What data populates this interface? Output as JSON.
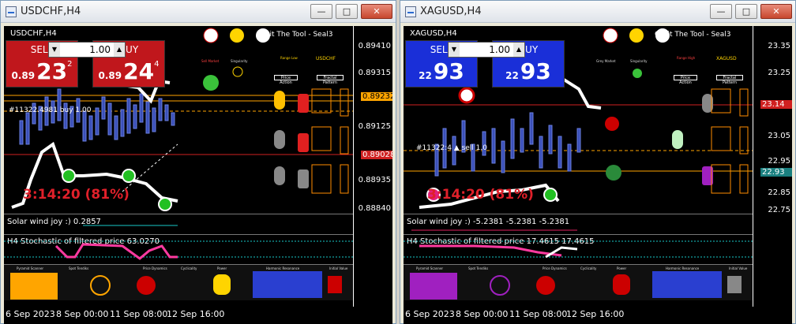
{
  "windows": [
    {
      "id": "left",
      "title": "USDCHF,H4",
      "symbol_label": "USDCHF,H4",
      "sell_label": "SELL",
      "buy_label": "BUY",
      "lot": "1.00",
      "sell_price": {
        "small": "0.89",
        "big": "23",
        "sup": "2"
      },
      "buy_price": {
        "small": "0.89",
        "big": "24",
        "sup": "4"
      },
      "seal_text": "Orbit The Tool - Seal3",
      "pair_tag": "USDCHF",
      "prices": [
        "0.89410",
        "0.89315",
        "0.89232",
        "0.89125",
        "0.89028",
        "0.88935",
        "0.88840"
      ],
      "trade_label": "#11322.4981 buy 1.00",
      "countdown": "3:14:20 (81%)",
      "solar_text": "Solar wind joy :) 0.2857",
      "stoch_text": "H4 Stochastic of filtered price 63.0270",
      "stoch_levels": [
        "80",
        "20"
      ],
      "time_labels": [
        "6 Sep 2023",
        "8 Sep 00:00",
        "11 Sep 08:00",
        "12 Sep 16:00"
      ],
      "colors": {
        "panel": "#c0171c",
        "accent": "#ff3030"
      },
      "indicators": [
        "Sell Market",
        "Singularity",
        "Range Low",
        "Price Action",
        "Fractal Pattern"
      ]
    },
    {
      "id": "right",
      "title": "XAGUSD,H4",
      "symbol_label": "XAGUSD,H4",
      "sell_label": "SELL",
      "buy_label": "BUY",
      "lot": "1.00",
      "sell_price": {
        "small": "22",
        "big": "93",
        "sup": ""
      },
      "buy_price": {
        "small": "22",
        "big": "93",
        "sup": ""
      },
      "seal_text": "Orbit The Tool - Seal3",
      "pair_tag": "XAGUSD",
      "prices": [
        "23.35",
        "23.25",
        "23.14",
        "23.05",
        "22.95",
        "22.93",
        "22.85",
        "22.75"
      ],
      "trade_label": "#11322:4 ▲ sell 1.0",
      "countdown": "3:14:20 (81%)",
      "solar_text": "Solar wind joy :) -5.2381 -5.2381 -5.2381",
      "stoch_text": "H4 Stochastic of filtered price 17.4615 17.4615",
      "stoch_levels": [
        "80",
        "20"
      ],
      "time_labels": [
        "6 Sep 2023",
        "8 Sep 00:00",
        "11 Sep 08:00",
        "12 Sep 16:00"
      ],
      "colors": {
        "panel": "#1a2fd8",
        "accent": "#3850ff"
      },
      "indicators": [
        "Grey Market",
        "Singularity",
        "Range High",
        "Price Action",
        "Fractal Pattern"
      ]
    }
  ],
  "bottom_labels": [
    "Pyramid Scanner",
    "Spot Tendiks",
    "Price Dynamics",
    "Cyclicality",
    "Power",
    "Harmonic Resonance",
    "Initial Value"
  ],
  "title_buttons": {
    "minimize": "—",
    "maximize": "□",
    "close": "✕"
  }
}
